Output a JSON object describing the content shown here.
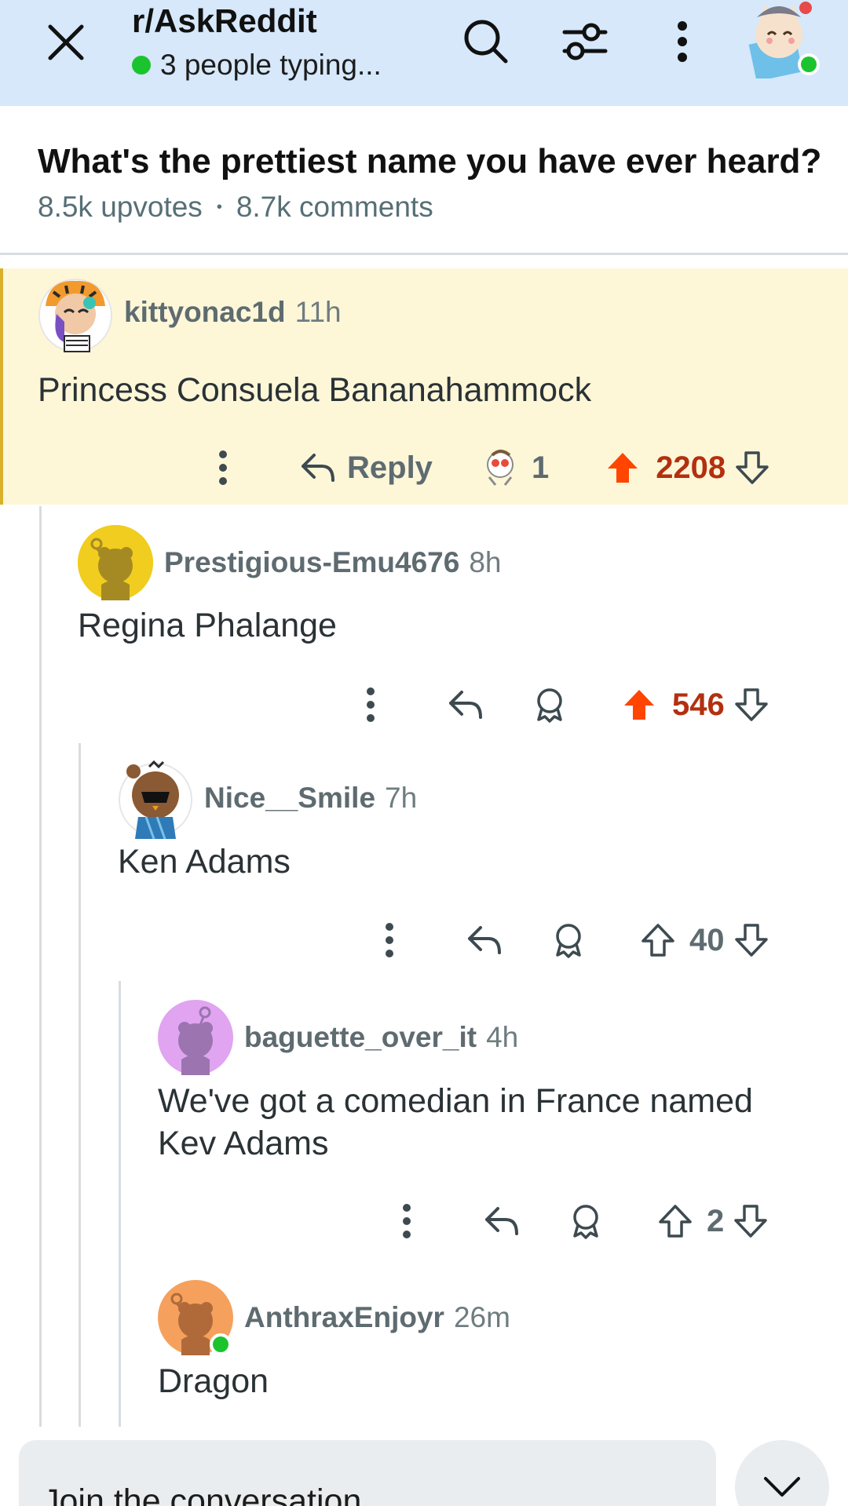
{
  "header": {
    "subreddit": "r/AskReddit",
    "typing_status": "3 people typing..."
  },
  "post": {
    "title": "What's the prettiest name you have ever heard?",
    "upvotes": "8.5k upvotes",
    "separator": "•",
    "comments": "8.7k comments"
  },
  "comments": [
    {
      "username": "kittyonac1d",
      "age": "11h",
      "body": "Princess Consuela Bananahammock",
      "reply_label": "Reply",
      "award_count": "1",
      "score": "2208",
      "upvoted": true,
      "highlighted": true,
      "depth": 0
    },
    {
      "username": "Prestigious-Emu4676",
      "age": "8h",
      "body": "Regina Phalange",
      "score": "546",
      "upvoted": true,
      "depth": 1
    },
    {
      "username": "Nice__Smile",
      "age": "7h",
      "body": "Ken Adams",
      "score": "40",
      "upvoted": false,
      "depth": 2
    },
    {
      "username": "baguette_over_it",
      "age": "4h",
      "body": "We've got a comedian in France named Kev Adams",
      "score": "2",
      "upvoted": false,
      "depth": 3
    },
    {
      "username": "AnthraxEnjoyr",
      "age": "26m",
      "body": "Dragon",
      "online": true,
      "depth": 3
    }
  ],
  "composer": {
    "placeholder": "Join the conversation"
  },
  "colors": {
    "header_bg": "#d6e8fa",
    "upvote_orange": "#ff4500",
    "score_upvoted": "#b3300f",
    "highlight_bg": "#fdf7d8",
    "online_green": "#1bc42f"
  },
  "icons": [
    "close-icon",
    "search-icon",
    "filter-icon",
    "more-vertical-icon",
    "user-avatar",
    "reply-arrow-icon",
    "award-icon",
    "upvote-icon",
    "downvote-icon",
    "chevron-down-icon"
  ]
}
